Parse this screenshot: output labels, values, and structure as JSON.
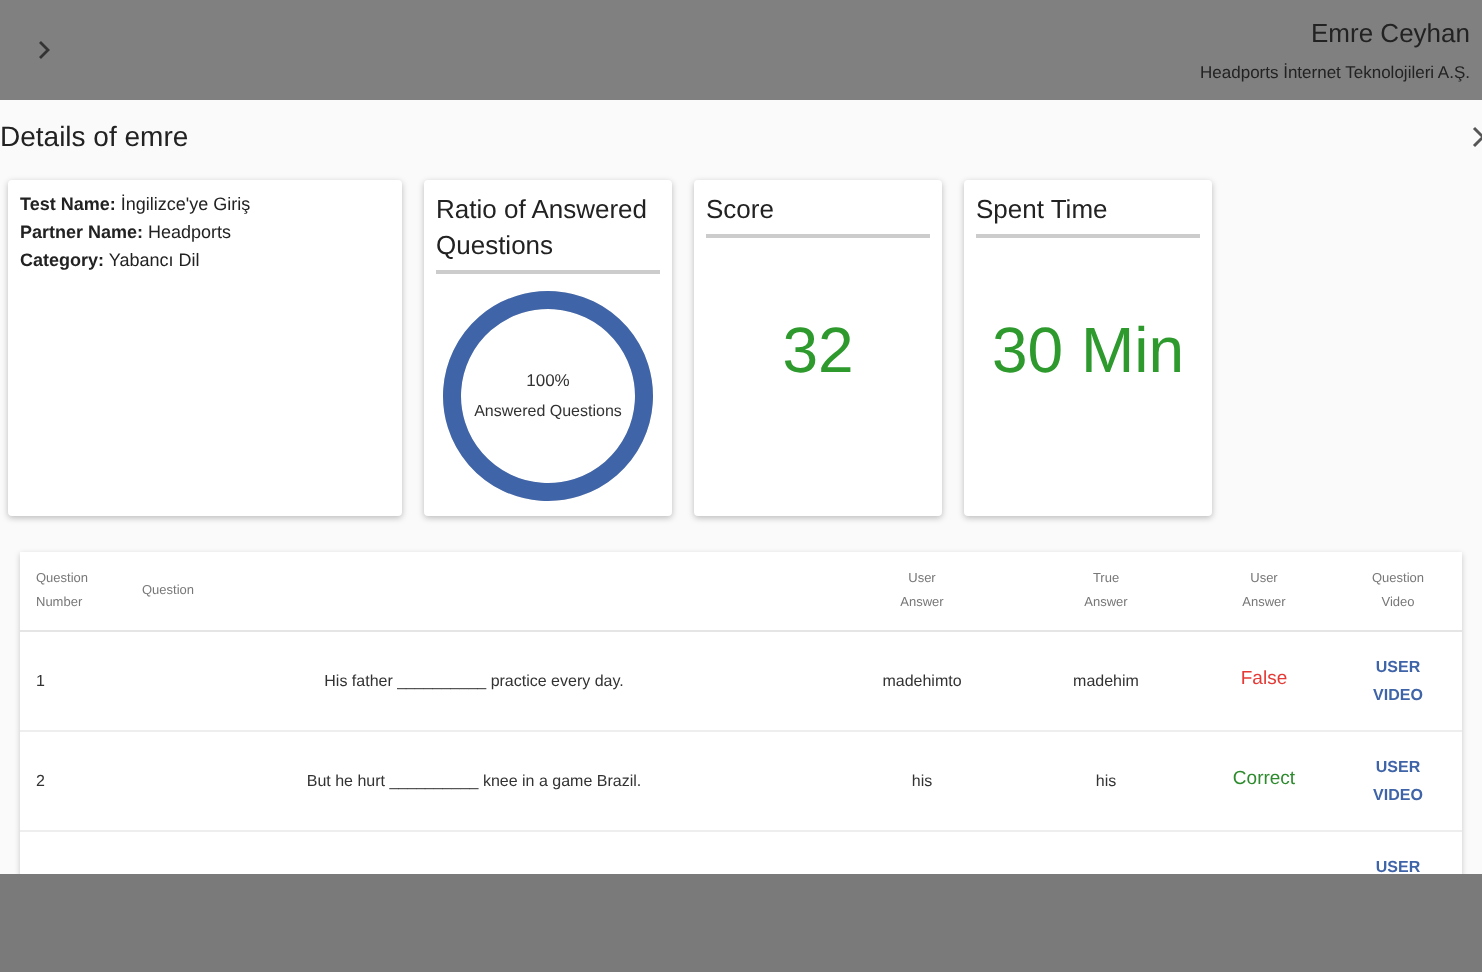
{
  "topbar": {
    "user_name": "Emre Ceyhan",
    "company": "Headports İnternet Teknolojileri A.Ş."
  },
  "dialog": {
    "title": "Details of emre",
    "info": [
      {
        "label": "Test Name:",
        "value": "İngilizce'ye Giriş"
      },
      {
        "label": "Partner Name:",
        "value": "Headports"
      },
      {
        "label": "Category:",
        "value": "Yabancı Dil"
      }
    ],
    "ratio_card": {
      "title": "Ratio of Answered Questions",
      "level": 1,
      "percent": "100%",
      "caption": "Answered Questions"
    },
    "score_card": {
      "title": "Score",
      "value": "32"
    },
    "time_card": {
      "title": "Spent Time",
      "value": "30 Min"
    },
    "table": {
      "columns": [
        "Question Number",
        "Question",
        "User Answer",
        "True Answer",
        "User Answer",
        "Question Video"
      ],
      "rows": [
        {
          "number": "1",
          "question": "His father __________ practice every day.",
          "user_answer": "madehimto",
          "true_answer": "madehim",
          "result": "False",
          "correct": false,
          "video": [
            "USER",
            "VIDEO"
          ]
        },
        {
          "number": "2",
          "question": "But he hurt __________ knee in a game Brazil.",
          "user_answer": "his",
          "true_answer": "his",
          "result": "Correct",
          "correct": true,
          "video": [
            "USER",
            "VIDEO"
          ]
        },
        {
          "video": [
            "USER"
          ]
        }
      ]
    }
  }
}
